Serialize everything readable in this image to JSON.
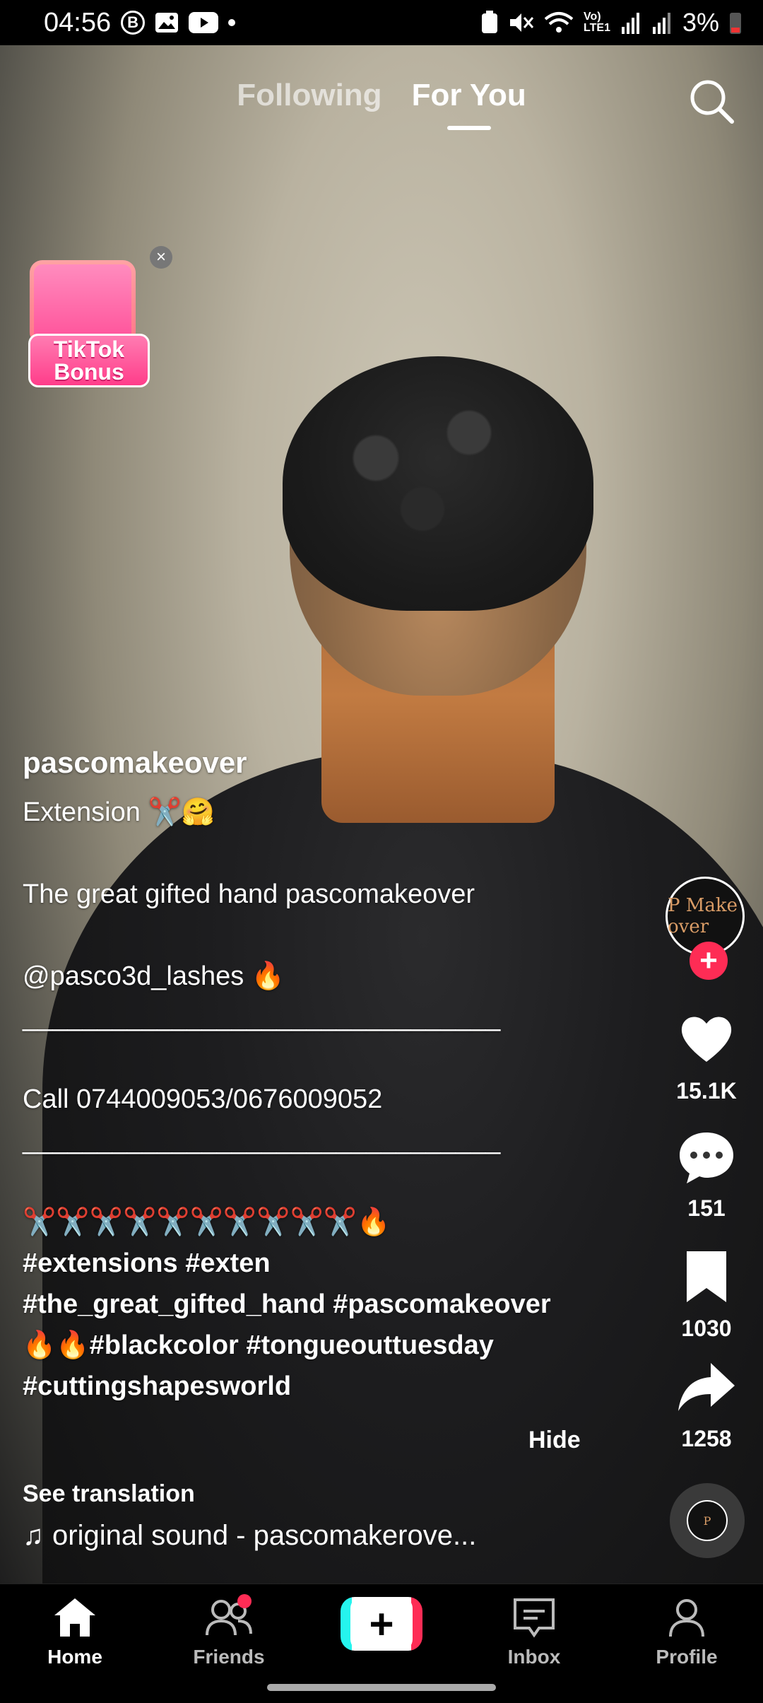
{
  "status_bar": {
    "time": "04:56",
    "battery": "3%"
  },
  "top_tabs": {
    "following": "Following",
    "for_you": "For You"
  },
  "bonus": {
    "line1": "TikTok",
    "line2": "Bonus"
  },
  "post": {
    "username": "pascomakeover",
    "caption_lines": [
      "Extension ✂️🤗",
      "",
      "The great gifted hand pascomakeover",
      "",
      "@pasco3d_lashes 🔥",
      "________________________________",
      "",
      "Call 0744009053/0676009052",
      "________________________________",
      "",
      "✂️✂️✂️✂️✂️✂️✂️✂️✂️✂️🔥"
    ],
    "hashtags": [
      "#extensions #exten",
      "#the_great_gifted_hand #pascomakeover",
      "🔥🔥#blackcolor #tongueouttuesday",
      "#cuttingshapesworld"
    ],
    "hide_label": "Hide",
    "see_translation": "See translation",
    "sound": "original sound - pascomakerove..."
  },
  "rail": {
    "avatar_text": "P Make over",
    "likes": "15.1K",
    "comments": "151",
    "saves": "1030",
    "shares": "1258"
  },
  "bottom_nav": {
    "home": "Home",
    "friends": "Friends",
    "inbox": "Inbox",
    "profile": "Profile"
  },
  "colors": {
    "accent": "#fe2c55",
    "cyan": "#25f4ee"
  }
}
